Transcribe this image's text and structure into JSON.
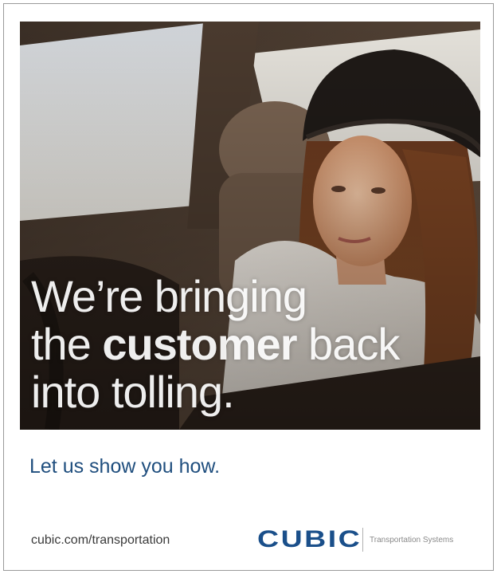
{
  "headline": {
    "line1": "We’re bringing",
    "line2_pre": "the ",
    "line2_strong": "customer",
    "line2_post": " back",
    "line3": "into tolling."
  },
  "tagline": "Let us show you how.",
  "url": "cubic.com/transportation",
  "logo": {
    "name": "CUBIC",
    "subtitle": "Transportation Systems"
  },
  "colors": {
    "brand_blue": "#1a4f8a",
    "tagline_blue": "#1f4e7e"
  }
}
